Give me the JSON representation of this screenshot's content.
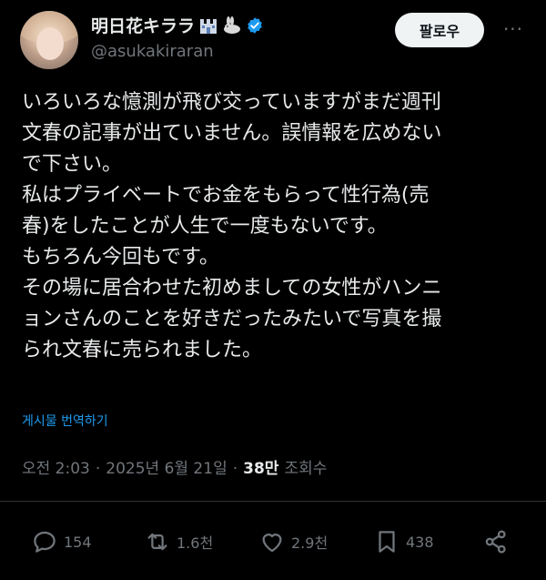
{
  "header": {
    "display_name": "明日花キララ",
    "handle": "@asukakiraran",
    "follow_label": "팔로우",
    "more_label": "···"
  },
  "tweet": {
    "lines": [
      "いろいろな憶測が飛び交っていますがまだ週刊",
      "文春の記事が出ていません。誤情報を広めない",
      "で下さい。",
      "私はプライベートでお金をもらって性行為(売",
      "春)をしたことが人生で一度もないです。",
      "もちろん今回もです。",
      "その場に居合わせた初めましての女性がハンニ",
      "ョンさんのことを好きだったみたいで写真を撮",
      "られ文春に売られました。"
    ],
    "translate_label": "게시물 번역하기"
  },
  "meta": {
    "time": "오전 2:03",
    "sep1": "·",
    "date": "2025년 6월 21일",
    "sep2": "·",
    "views_count": "38만",
    "views_label": "조회수"
  },
  "actions": {
    "replies": "154",
    "reposts": "1.6천",
    "likes": "2.9천",
    "bookmarks": "438"
  },
  "colors": {
    "background": "#000000",
    "text": "#e7e9ea",
    "muted": "#71767b",
    "link": "#1d9bf0",
    "verified": "#1d9bf0"
  },
  "icons": [
    "castle-emoji-icon",
    "rabbit-emoji-icon",
    "verified-badge-icon",
    "more-icon",
    "reply-icon",
    "repost-icon",
    "like-icon",
    "bookmark-icon",
    "share-icon"
  ]
}
